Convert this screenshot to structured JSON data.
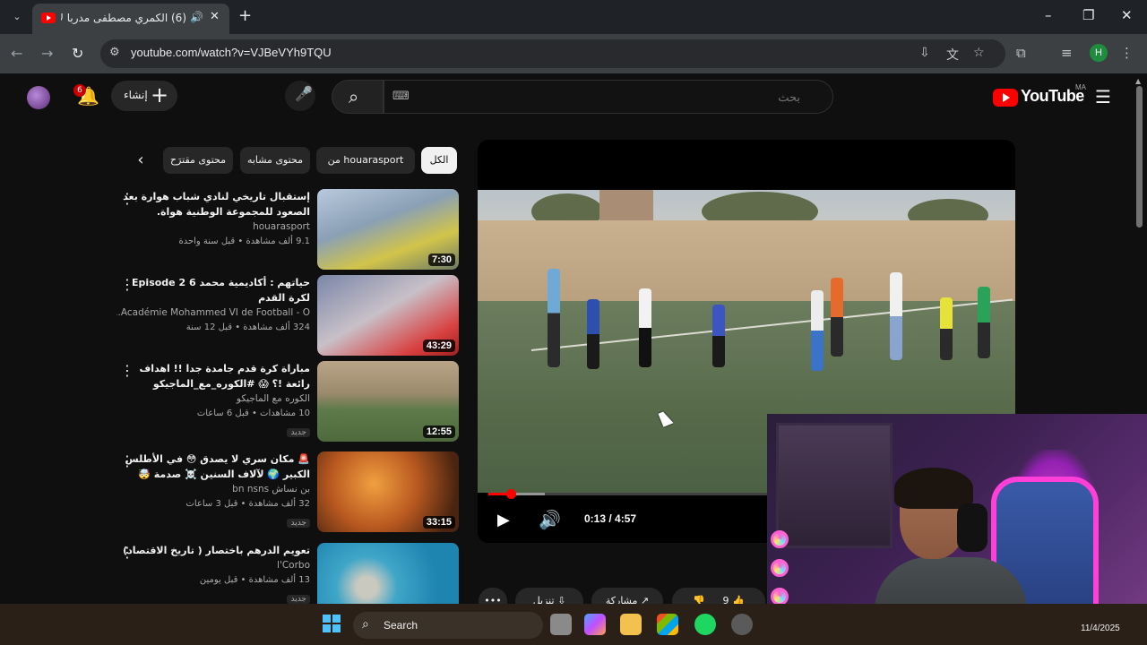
{
  "browser": {
    "tab_title": "(6) الكمري مصطفى مدربا لأ...",
    "tab_audio_icon": "speaker-icon",
    "url": "youtube.com/watch?v=VJBeVYh9TQU",
    "window_controls": [
      "–",
      "❐",
      "✕"
    ]
  },
  "youtube": {
    "notification_count": "6",
    "create_label": "إنشاء",
    "search_placeholder": "بحث",
    "logo_text": "YouTube",
    "country_code": "MA"
  },
  "chips": [
    {
      "label": "الكل",
      "active": true
    },
    {
      "label": "من houarasport",
      "active": false
    },
    {
      "label": "محتوى مشابه",
      "active": false
    },
    {
      "label": "محتوى مقترَح",
      "active": false
    }
  ],
  "recommendations": [
    {
      "title": "إستقبال تاريخي لنادي شباب هوارة بعد الصعود للمجموعة الوطنية هواة.",
      "channel": "houarasport",
      "meta": "9.1 ألف مشاهدة • قبل سنة واحدة",
      "duration": "7:30",
      "badge": ""
    },
    {
      "title": "حياتهم : أكاديمية محمد 6 Episode 2 لكرة القدم",
      "channel": "Académie Mohammed VI de Football - O...",
      "meta": "324 ألف مشاهدة • قبل 12 سنة",
      "duration": "43:29",
      "badge": ""
    },
    {
      "title": "مباراة كرة قدم جامدة جدا !! اهداف رائعة !؟ 😱 #الكوره_مع_الماجيكو #كرة_القدم ...",
      "channel": "الكوره مع الماجيكو",
      "meta": "10 مشاهدات • قبل 6 ساعات",
      "duration": "12:55",
      "badge": "جديد"
    },
    {
      "title": "🚨 مكان سري لا يصدق 😳 في الأطلس الكبير 🌍 لآلاف السنين ☠️ صدمة 🤯",
      "channel": "بن نساش bn nsns",
      "meta": "32 ألف مشاهدة • قبل 3 ساعات",
      "duration": "33:15",
      "badge": "جديد"
    },
    {
      "title": "تعويم الدرهم باختصار ( تاريخ الاقتصاد)",
      "channel": "l'Corbo",
      "meta": "13 ألف مشاهدة • قبل يومين",
      "duration": "",
      "badge": "جديد"
    }
  ],
  "player": {
    "time_display": "0:13 / 4:57",
    "progress_fraction": 0.044,
    "buffered_fraction": 0.11
  },
  "actions": {
    "like_count": "9",
    "share_label": "مشاركة",
    "download_label": "تنزيل",
    "more_label": "•••"
  },
  "taskbar": {
    "search_label": "Search",
    "date": "11/4/2025"
  }
}
